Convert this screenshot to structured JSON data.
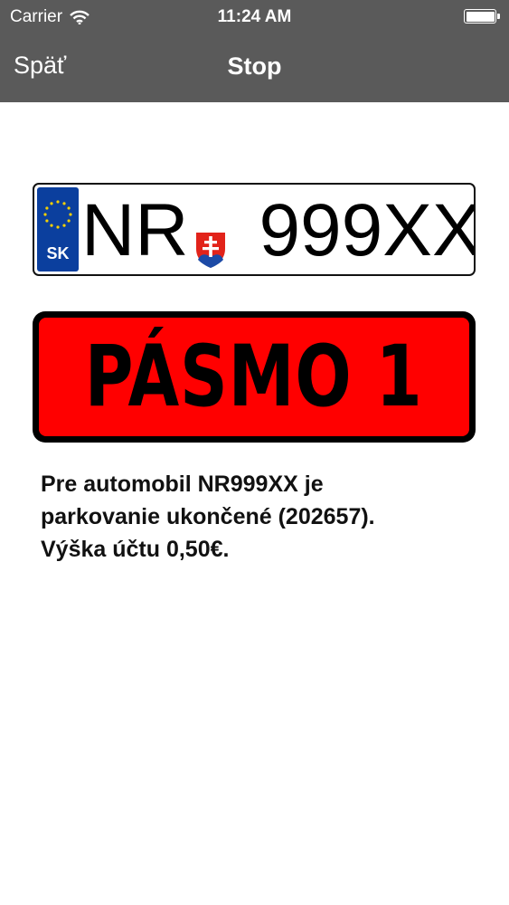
{
  "status_bar": {
    "carrier": "Carrier",
    "time": "11:24 AM",
    "wifi_icon": "wifi-icon",
    "battery_icon": "battery-icon"
  },
  "nav": {
    "back_label": "Späť",
    "title": "Stop"
  },
  "plate": {
    "country_code": "SK",
    "district": "NR",
    "number": "999XX",
    "eu_icon": "eu-stars-icon",
    "crest_icon": "slovak-coat-of-arms-icon"
  },
  "zone": {
    "label": "PÁSMO 1",
    "background": "#ff0000"
  },
  "message": {
    "text": "Pre automobil NR999XX je\nparkovanie ukončené (202657).\nVýška účtu 0,50€."
  },
  "colors": {
    "navbar": "#5a5a5a",
    "eu_band": "#0b3f9e"
  }
}
